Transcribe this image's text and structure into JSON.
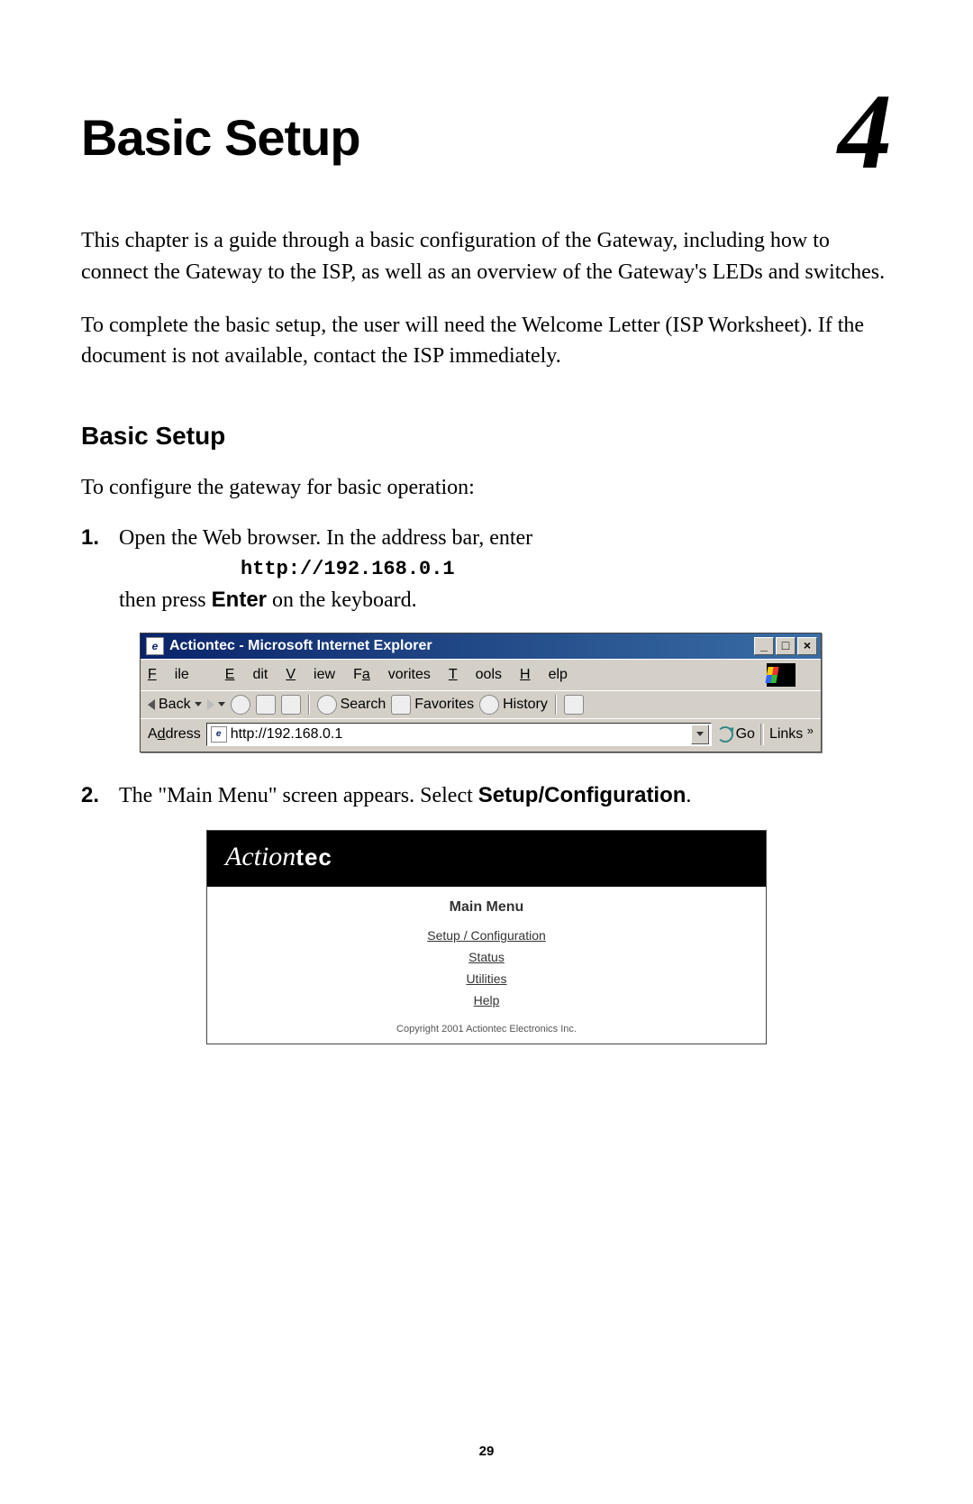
{
  "chapter": {
    "title": "Basic Setup",
    "number": "4"
  },
  "intro1": "This chapter is a guide through a basic configuration of the Gateway, including how to connect the Gateway to the ISP, as well as an overview of the Gateway's LEDs and switches.",
  "intro2": "To complete the basic setup, the user will need the Welcome Letter (ISP Worksheet). If the document is not available, contact the ISP immediately.",
  "section1": {
    "heading": "Basic Setup",
    "lead": "To configure the gateway for basic operation:"
  },
  "steps": {
    "s1": {
      "num": "1.",
      "line1": "Open the Web browser. In the address bar, enter",
      "url": "http://192.168.0.1",
      "line2a": "then press ",
      "line2bold": "Enter",
      "line2b": " on the keyboard."
    },
    "s2": {
      "num": "2.",
      "line_a": "The \"Main Menu\" screen appears. Select ",
      "line_bold": "Setup/Configuration",
      "line_b": "."
    }
  },
  "ie": {
    "title": "Actiontec - Microsoft Internet Explorer",
    "menu": {
      "file": "File",
      "edit": "Edit",
      "view": "View",
      "favorites": "Favorites",
      "tools": "Tools",
      "help": "Help"
    },
    "toolbar": {
      "back": "Back",
      "search": "Search",
      "favorites": "Favorites",
      "history": "History"
    },
    "address_label": "Address",
    "address_value": "http://192.168.0.1",
    "go": "Go",
    "links": "Links"
  },
  "at": {
    "brand_a": "Action",
    "brand_tec": "tec",
    "title": "Main Menu",
    "links": {
      "setup": "Setup / Configuration",
      "status": "Status",
      "utilities": "Utilities",
      "help": "Help"
    },
    "copy": "Copyright 2001 Actiontec Electronics Inc."
  },
  "page_number": "29"
}
